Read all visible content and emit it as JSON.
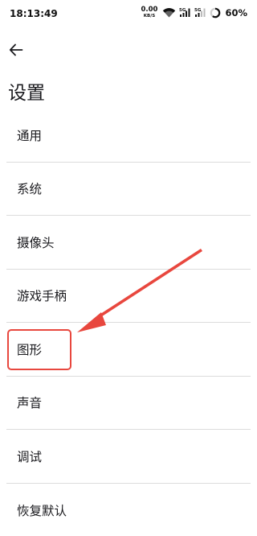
{
  "status_bar": {
    "time": "18:13:49",
    "net_speed_value": "0.00",
    "net_speed_unit": "KB/S",
    "signal_label": "5G",
    "battery": "60%",
    "battery_level": 0.6
  },
  "header": {
    "title": "设置"
  },
  "settings": {
    "items": [
      {
        "label": "通用"
      },
      {
        "label": "系统"
      },
      {
        "label": "摄像头"
      },
      {
        "label": "游戏手柄"
      },
      {
        "label": "图形"
      },
      {
        "label": "声音"
      },
      {
        "label": "调试"
      },
      {
        "label": "恢复默认"
      }
    ]
  },
  "annotation": {
    "color": "#e8473e",
    "target": "图形"
  }
}
